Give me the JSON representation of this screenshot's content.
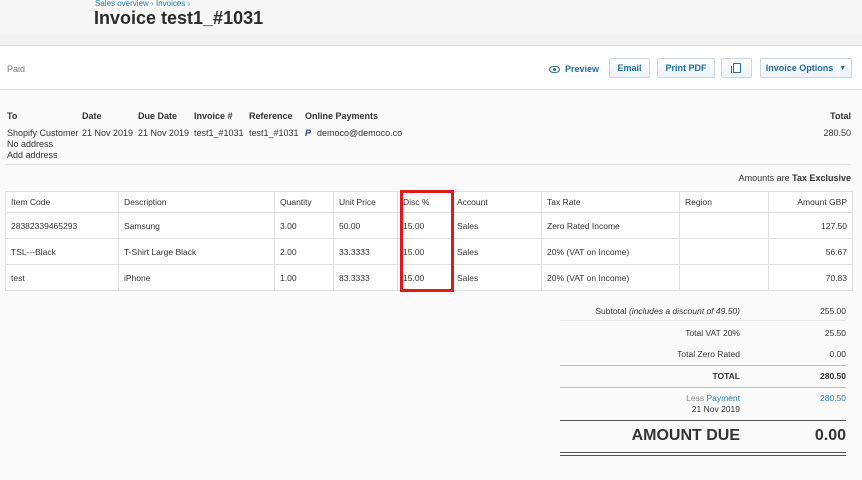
{
  "header": {
    "breadcrumb": [
      "Sales overview",
      "Invoices"
    ],
    "breadcrumb_sep": "›",
    "title": "Invoice test1_#1031"
  },
  "status": "Paid",
  "toolbar": {
    "preview_label": "Preview",
    "email_label": "Email",
    "print_pdf_label": "Print PDF",
    "invoice_options_label": "Invoice Options",
    "copy_icon": "copy-icon",
    "preview_icon": "eye-icon"
  },
  "details": {
    "to_label": "To",
    "to_name": "Shopify Customer",
    "to_address": "No address",
    "add_address_label": "Add address",
    "date_label": "Date",
    "date": "21 Nov 2019",
    "due_label": "Due Date",
    "due": "21 Nov 2019",
    "invoice_label": "Invoice #",
    "invoice": "test1_#1031",
    "reference_label": "Reference",
    "reference": "test1_#1031",
    "online_label": "Online Payments",
    "online_email": "democo@democo.co",
    "paypal_icon": "paypal-icon",
    "total_label": "Total",
    "total": "280.50"
  },
  "amounts_note_prefix": "Amounts are",
  "amounts_note_value": "Tax Exclusive",
  "table": {
    "columns": [
      "Item Code",
      "Description",
      "Quantity",
      "Unit Price",
      "Disc %",
      "Account",
      "Tax Rate",
      "Region",
      "Amount GBP"
    ],
    "rows": [
      {
        "code": "28382339465293",
        "desc": "Samsung",
        "qty": "3.00",
        "price": "50.00",
        "disc": "15.00",
        "account": "Sales",
        "tax": "Zero Rated Income",
        "region": "",
        "amount": "127.50"
      },
      {
        "code": "TSL---Black",
        "desc": "T-Shirt Large Black",
        "qty": "2.00",
        "price": "33.3333",
        "disc": "15.00",
        "account": "Sales",
        "tax": "20% (VAT on Income)",
        "region": "",
        "amount": "56.67"
      },
      {
        "code": "test",
        "desc": "iPhone",
        "qty": "1.00",
        "price": "83.3333",
        "disc": "15.00",
        "account": "Sales",
        "tax": "20% (VAT on Income)",
        "region": "",
        "amount": "70.83"
      }
    ]
  },
  "highlight_color": "#dc1b1b",
  "totals": {
    "subtotal_label": "Subtotal",
    "subtotal_note": "(includes a discount of 49.50)",
    "subtotal": "255.00",
    "vat_label": "Total VAT  20%",
    "vat": "25.50",
    "zero_label": "Total Zero Rated",
    "zero": "0.00",
    "total_label": "TOTAL",
    "total": "280.50",
    "less_label": "Less",
    "payment_label": "Payment",
    "payment_date": "21 Nov 2019",
    "payment": "280.50",
    "amount_due_label": "AMOUNT DUE",
    "amount_due": "0.00"
  }
}
